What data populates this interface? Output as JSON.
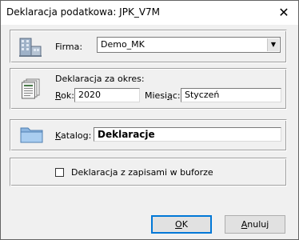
{
  "window": {
    "title": "Deklaracja podatkowa: JPK_V7M"
  },
  "firma": {
    "label_prefix": "",
    "label": "Firma:",
    "value": "Demo_MK",
    "icon": "building-icon"
  },
  "okres": {
    "label": "Deklaracja za okres:",
    "rok_label_u": "R",
    "rok_label_rest": "ok:",
    "rok_value": "2020",
    "miesiac_label_a": "Miesi",
    "miesiac_label_u": "ą",
    "miesiac_label_b": "c:",
    "miesiac_value": "Styczeń",
    "icon": "documents-icon"
  },
  "katalog": {
    "label_u": "K",
    "label_rest": "atalog:",
    "value": "Deklaracje",
    "icon": "folder-icon"
  },
  "bufor": {
    "label": "Deklaracja z zapisami w buforze",
    "checked": false
  },
  "buttons": {
    "ok_u": "O",
    "ok_rest": "K",
    "cancel_u": "A",
    "cancel_rest": "nuluj"
  }
}
